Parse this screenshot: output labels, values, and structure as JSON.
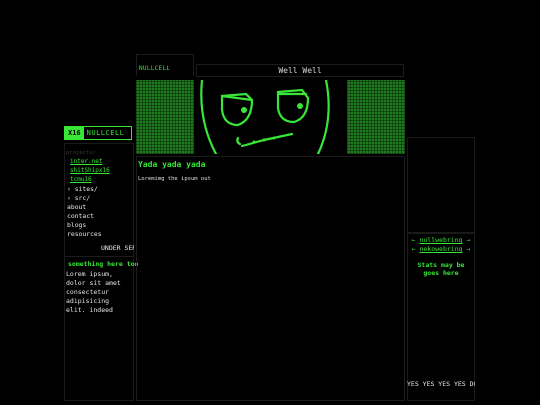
{
  "header": {
    "tag": "NULLCELL",
    "title": "Well Well"
  },
  "logo": {
    "badge": "X16",
    "name": "NULLCELL"
  },
  "nav": {
    "heading": "projects/",
    "sub_items": [
      "inter.net",
      "shitShipx16",
      "tcmu16"
    ],
    "items": [
      "› sites/",
      "› src/",
      "about",
      "contact",
      "blogs",
      "resources"
    ]
  },
  "sidebar": {
    "under": "UNDER SER",
    "box_title": "something here too",
    "box_text": "Lorem ipsum, dolor sit amet consectetur adipisicing elit. indeed"
  },
  "main": {
    "title": "Yada yada yada",
    "text": "Loremimg the ipsum out"
  },
  "right": {
    "ring1": {
      "prev": "←",
      "name": "nullwebring",
      "next": "→"
    },
    "ring2": {
      "prev": "←",
      "name": "nekowebring",
      "next": "→"
    },
    "stats": "Stats may be goes here",
    "marquee": "YES YES YES YES DOP"
  },
  "colors": {
    "accent": "#37e637",
    "background": "#000000",
    "banner_pattern": "#1f7a1f"
  },
  "icons": {
    "banner_face": "grumpy-face-icon"
  }
}
